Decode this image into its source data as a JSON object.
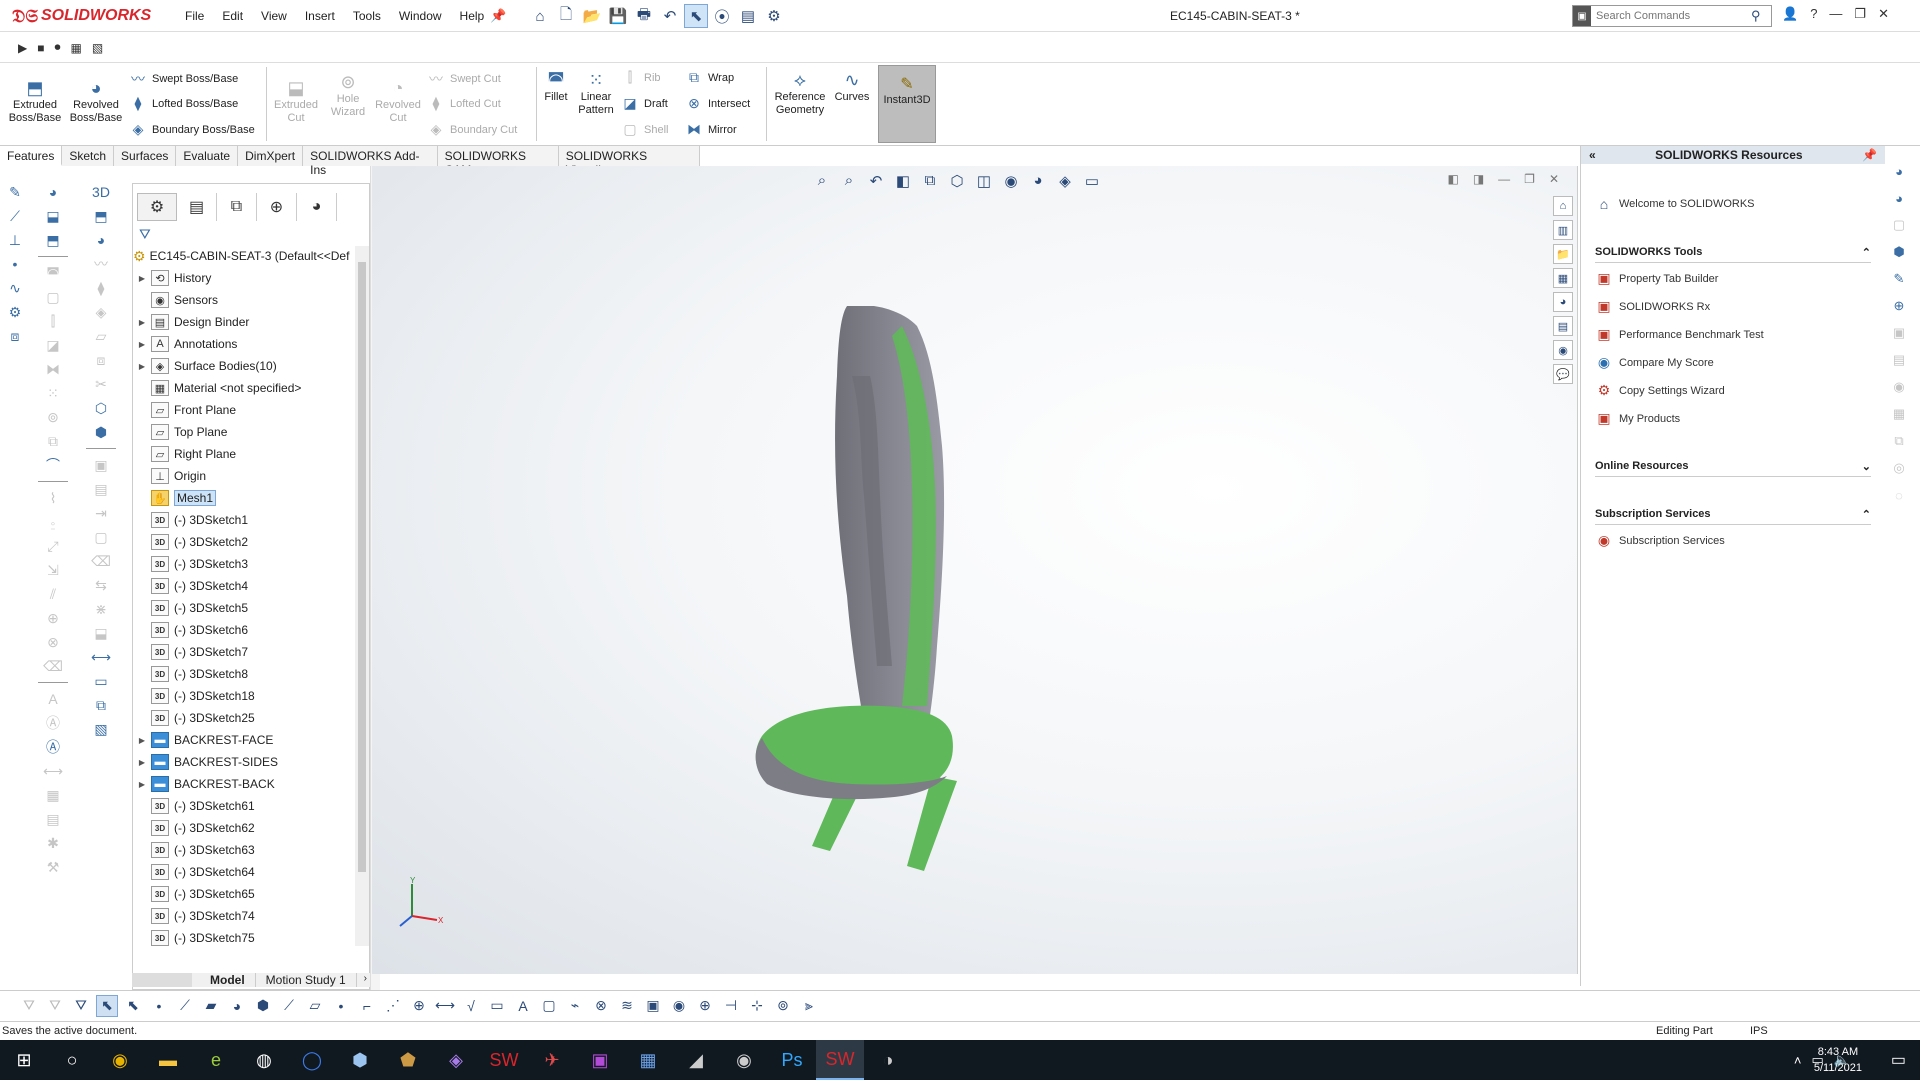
{
  "app": {
    "brand": "SOLIDWORKS",
    "document_title": "EC145-CABIN-SEAT-3 *",
    "menus": [
      "File",
      "Edit",
      "View",
      "Insert",
      "Tools",
      "Window",
      "Help"
    ],
    "search_placeholder": "Search Commands"
  },
  "command_manager": {
    "extruded": "Extruded Boss/Base",
    "revolved": "Revolved Boss/Base",
    "swept": "Swept Boss/Base",
    "lofted": "Lofted Boss/Base",
    "boundary": "Boundary Boss/Base",
    "extruded_cut": "Extruded Cut",
    "hole_wizard": "Hole Wizard",
    "revolved_cut": "Revolved Cut",
    "swept_cut": "Swept Cut",
    "lofted_cut": "Lofted Cut",
    "boundary_cut": "Boundary Cut",
    "fillet": "Fillet",
    "linear_pattern": "Linear Pattern",
    "rib": "Rib",
    "draft": "Draft",
    "shell": "Shell",
    "wrap": "Wrap",
    "intersect": "Intersect",
    "mirror": "Mirror",
    "reference_geometry": "Reference Geometry",
    "curves": "Curves",
    "instant3d": "Instant3D"
  },
  "tabs": [
    "Features",
    "Sketch",
    "Surfaces",
    "Evaluate",
    "DimXpert",
    "SOLIDWORKS Add-Ins",
    "SOLIDWORKS CAM",
    "SOLIDWORKS Visualize"
  ],
  "feature_tree": {
    "root": "EC145-CABIN-SEAT-3  (Default<<Def",
    "items": [
      {
        "label": "History",
        "icon": "history-icon",
        "expandable": true
      },
      {
        "label": "Sensors",
        "icon": "sensor-icon",
        "expandable": false
      },
      {
        "label": "Design Binder",
        "icon": "binder-icon",
        "expandable": true
      },
      {
        "label": "Annotations",
        "icon": "annotation-icon",
        "expandable": true
      },
      {
        "label": "Surface Bodies(10)",
        "icon": "surface-icon",
        "expandable": true
      },
      {
        "label": "Material <not specified>",
        "icon": "material-icon",
        "expandable": false
      },
      {
        "label": "Front Plane",
        "icon": "plane-icon",
        "expandable": false
      },
      {
        "label": "Top Plane",
        "icon": "plane-icon",
        "expandable": false
      },
      {
        "label": "Right Plane",
        "icon": "plane-icon",
        "expandable": false
      },
      {
        "label": "Origin",
        "icon": "origin-icon",
        "expandable": false
      },
      {
        "label": "Mesh1",
        "icon": "mesh-icon",
        "expandable": false,
        "selected": true
      },
      {
        "label": "(-) 3DSketch1",
        "icon": "sketch3d-icon",
        "expandable": false
      },
      {
        "label": "(-) 3DSketch2",
        "icon": "sketch3d-icon",
        "expandable": false
      },
      {
        "label": "(-) 3DSketch3",
        "icon": "sketch3d-icon",
        "expandable": false
      },
      {
        "label": "(-) 3DSketch4",
        "icon": "sketch3d-icon",
        "expandable": false
      },
      {
        "label": "(-) 3DSketch5",
        "icon": "sketch3d-icon",
        "expandable": false
      },
      {
        "label": "(-) 3DSketch6",
        "icon": "sketch3d-icon",
        "expandable": false
      },
      {
        "label": "(-) 3DSketch7",
        "icon": "sketch3d-icon",
        "expandable": false
      },
      {
        "label": "(-) 3DSketch8",
        "icon": "sketch3d-icon",
        "expandable": false
      },
      {
        "label": "(-) 3DSketch18",
        "icon": "sketch3d-icon",
        "expandable": false
      },
      {
        "label": "(-) 3DSketch25",
        "icon": "sketch3d-icon",
        "expandable": false
      },
      {
        "label": "BACKREST-FACE",
        "icon": "folder-icon",
        "expandable": true
      },
      {
        "label": "BACKREST-SIDES",
        "icon": "folder-icon",
        "expandable": true
      },
      {
        "label": "BACKREST-BACK",
        "icon": "folder-icon",
        "expandable": true
      },
      {
        "label": "(-) 3DSketch61",
        "icon": "sketch3d-icon",
        "expandable": false
      },
      {
        "label": "(-) 3DSketch62",
        "icon": "sketch3d-icon",
        "expandable": false
      },
      {
        "label": "(-) 3DSketch63",
        "icon": "sketch3d-icon",
        "expandable": false
      },
      {
        "label": "(-) 3DSketch64",
        "icon": "sketch3d-icon",
        "expandable": false
      },
      {
        "label": "(-) 3DSketch65",
        "icon": "sketch3d-icon",
        "expandable": false
      },
      {
        "label": "(-) 3DSketch74",
        "icon": "sketch3d-icon",
        "expandable": false
      },
      {
        "label": "(-) 3DSketch75",
        "icon": "sketch3d-icon",
        "expandable": false
      }
    ]
  },
  "bottom_tabs": [
    "Model",
    "Motion Study 1"
  ],
  "task_pane": {
    "title": "SOLIDWORKS Resources",
    "welcome": "Welcome to SOLIDWORKS",
    "tools_header": "SOLIDWORKS Tools",
    "tools": [
      "Property Tab Builder",
      "SOLIDWORKS Rx",
      "Performance Benchmark Test",
      "Compare My Score",
      "Copy Settings Wizard",
      "My Products"
    ],
    "online_header": "Online Resources",
    "subscription_header": "Subscription Services",
    "subscription_item": "Subscription Services"
  },
  "status": {
    "message": "Saves the active document.",
    "mode": "Editing Part",
    "units": "IPS"
  },
  "taskbar": {
    "time": "8:43 AM",
    "date": "5/11/2021"
  },
  "colors": {
    "brand_red": "#d9262c",
    "seat_green": "#5fb85a",
    "seat_gray": "#7d7d86"
  }
}
